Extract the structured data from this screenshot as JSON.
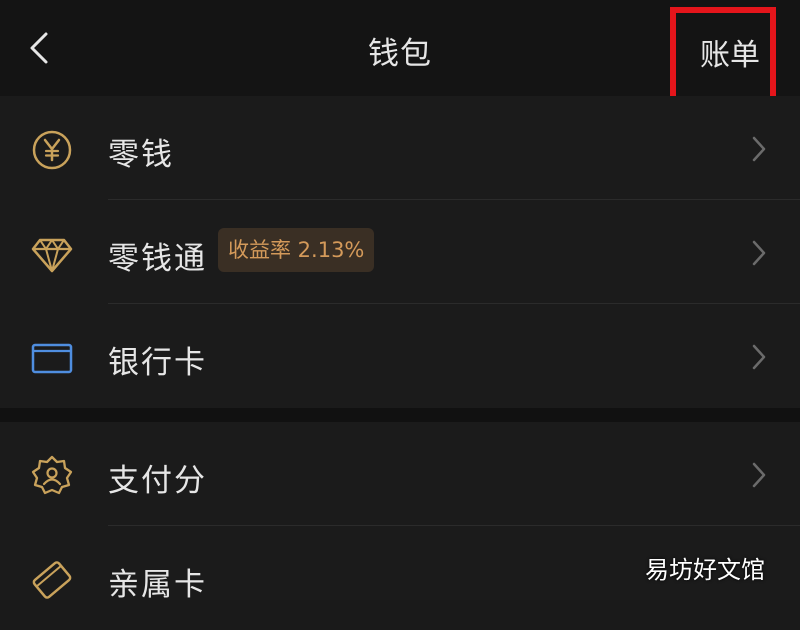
{
  "header": {
    "title": "钱包",
    "bill_label": "账单"
  },
  "highlight_color": "#e4151b",
  "group1": [
    {
      "icon": "yuan-coin-icon",
      "label": "零钱"
    },
    {
      "icon": "diamond-icon",
      "label": "零钱通",
      "badge": "收益率 2.13%"
    },
    {
      "icon": "bank-card-icon",
      "label": "银行卡"
    }
  ],
  "group2": [
    {
      "icon": "pay-score-badge-icon",
      "label": "支付分"
    },
    {
      "icon": "family-card-icon",
      "label": "亲属卡"
    }
  ],
  "colors": {
    "gold": "#c9a25b",
    "blue": "#4f8ee0",
    "badge_text": "#d49a5a"
  },
  "watermark": "易坊好文馆"
}
